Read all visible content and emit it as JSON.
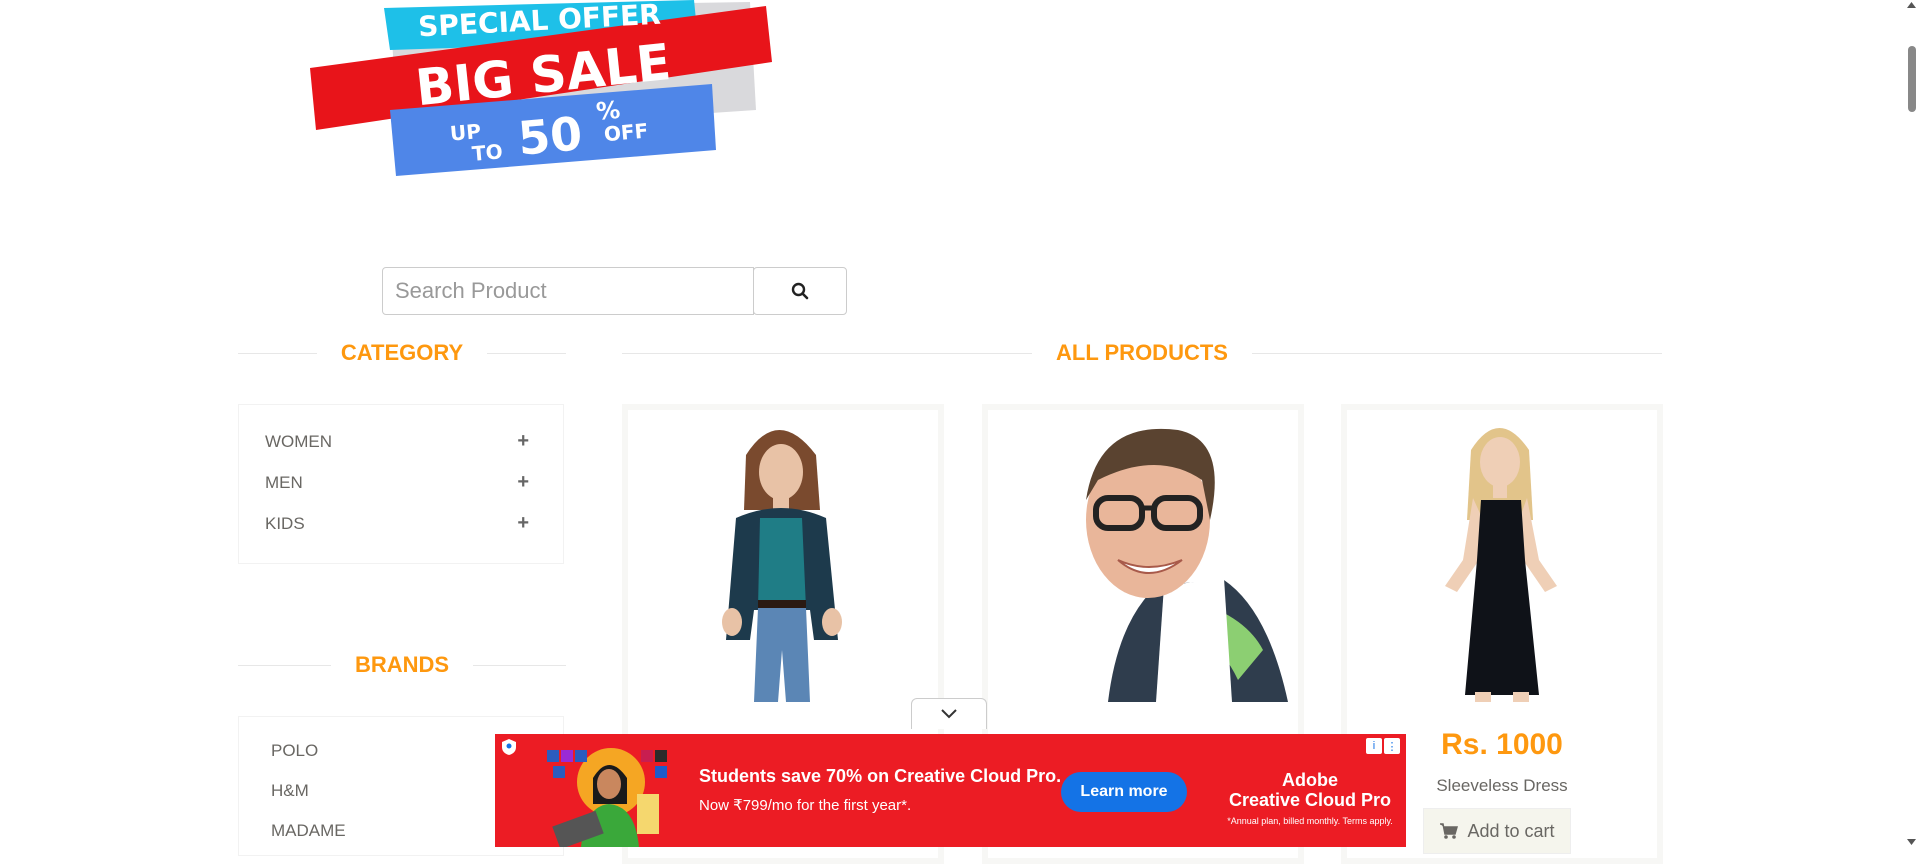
{
  "banner": {
    "line1": "SPECIAL OFFER",
    "line2": "BIG SALE",
    "line3_up": "UP",
    "line3_to": "TO",
    "line3_pct": "50",
    "line3_sym": "%",
    "line3_off": "OFF",
    "colors": {
      "cyan": "#1ec0e8",
      "red": "#e8141a",
      "blue": "#4f86e8"
    }
  },
  "search": {
    "placeholder": "Search Product",
    "icon": "search-icon"
  },
  "sections": {
    "category_title": "CATEGORY",
    "products_title": "ALL PRODUCTS",
    "brands_title": "BRANDS"
  },
  "categories": [
    {
      "label": "WOMEN",
      "icon": "plus-icon"
    },
    {
      "label": "MEN",
      "icon": "plus-icon"
    },
    {
      "label": "KIDS",
      "icon": "plus-icon"
    }
  ],
  "brands": [
    "POLO",
    "H&M",
    "MADAME"
  ],
  "products": [
    {
      "price": "",
      "name": "",
      "image": "woman-cardigan-jeans"
    },
    {
      "price": "",
      "name": "",
      "image": "man-glasses-smiling"
    },
    {
      "price": "Rs. 1000",
      "name": "Sleeveless Dress",
      "button": "Add to cart",
      "image": "woman-black-dress"
    }
  ],
  "ad": {
    "headline": "Students save 70% on Creative Cloud Pro.",
    "sub": "Now ₹799/mo for the first year*.",
    "cta": "Learn more",
    "brand_line1": "Adobe",
    "brand_line2": "Creative Cloud Pro",
    "fine_print": "*Annual plan, billed monthly. Terms apply.",
    "info_icon": "i",
    "menu_icon": "⋮",
    "colors": {
      "background": "#ec1c24",
      "button": "#1473e6"
    }
  },
  "colors": {
    "accent": "#fe980f",
    "text": "#696763"
  }
}
